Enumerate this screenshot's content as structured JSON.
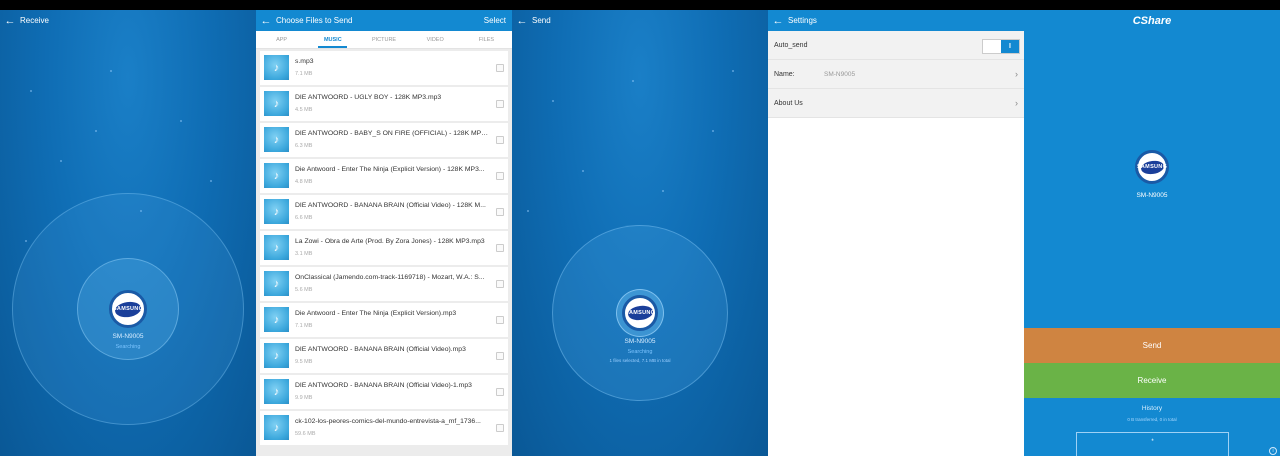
{
  "receive": {
    "title": "Receive",
    "device_name": "SM-N9005",
    "status": "Searching",
    "logo_text": "SAMSUNG"
  },
  "choose": {
    "title": "Choose Files to Send",
    "select_label": "Select",
    "tabs": [
      {
        "label": "APP"
      },
      {
        "label": "MUSIC"
      },
      {
        "label": "PICTURE"
      },
      {
        "label": "VIDEO"
      },
      {
        "label": "FILES"
      }
    ],
    "active_tab": "MUSIC",
    "files": [
      {
        "name": "s.mp3",
        "size": "7.1 MB"
      },
      {
        "name": "DIE ANTWOORD - UGLY BOY - 128K MP3.mp3",
        "size": "4.5 MB"
      },
      {
        "name": "DIE ANTWOORD - BABY_S ON FIRE (OFFICIAL) - 128K MP3...",
        "size": "6.3 MB"
      },
      {
        "name": "Die Antwoord - Enter The Ninja (Explicit Version) - 128K MP3...",
        "size": "4.8 MB"
      },
      {
        "name": "DIE ANTWOORD - BANANA BRAIN (Official Video) - 128K M...",
        "size": "6.6 MB"
      },
      {
        "name": "La Zowi - Obra de Arte (Prod. By Zora Jones) - 128K MP3.mp3",
        "size": "3.1 MB"
      },
      {
        "name": "OnClassical (Jamendo.com-track-1169718) - Mozart, W.A.: S...",
        "size": "5.6 MB"
      },
      {
        "name": "Die Antwoord - Enter The Ninja (Explicit Version).mp3",
        "size": "7.1 MB"
      },
      {
        "name": "DIE ANTWOORD - BANANA BRAIN (Official Video).mp3",
        "size": "9.5 MB"
      },
      {
        "name": "DIE ANTWOORD - BANANA BRAIN (Official Video)-1.mp3",
        "size": "9.9 MB"
      },
      {
        "name": "ck-102-los-peores-comics-del-mundo-entrevista-a_mf_1736...",
        "size": "59.6 MB"
      }
    ]
  },
  "send": {
    "title": "Send",
    "device_name": "SM-N9005",
    "status": "Searching",
    "selection_info": "1 files selected, 7.1 MB in total",
    "logo_text": "SAMSUNG"
  },
  "settings": {
    "title": "Settings",
    "auto_send_label": "Auto_send",
    "toggle_on_glyph": "I",
    "name_label": "Name:",
    "name_value": "SM-N9005",
    "about_label": "About Us"
  },
  "main": {
    "brand": "CShare",
    "device_name": "SM-N9005",
    "logo_text": "SAMSUNG",
    "send_label": "Send",
    "receive_label": "Receive",
    "history_label": "History",
    "history_info": "0 B transferred, 0 in total",
    "history_placeholder": "*"
  },
  "colors": {
    "accent": "#1389d1",
    "send": "#cf8441",
    "receive": "#6ab347"
  }
}
